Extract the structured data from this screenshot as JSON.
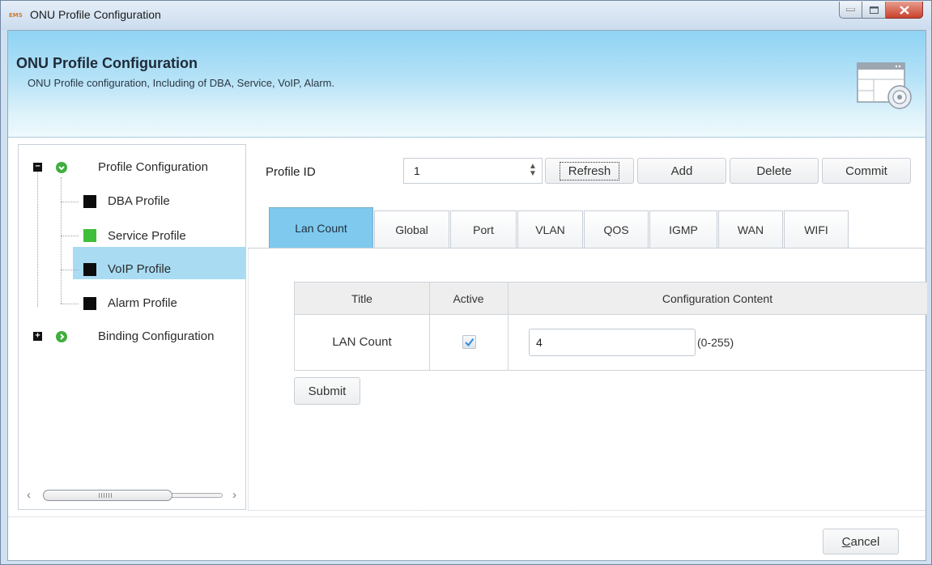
{
  "window": {
    "app_icon_text": "EMS",
    "title": "ONU Profile Configuration",
    "controls": [
      "minimize",
      "maximize",
      "close"
    ]
  },
  "header": {
    "title": "ONU Profile Configuration",
    "description": "ONU Profile configuration, Including of DBA, Service, VoIP, Alarm.",
    "icon": "window-gear-icon"
  },
  "tree": {
    "root": {
      "label": "Profile Configuration",
      "expanded": true,
      "children": [
        {
          "label": "DBA Profile",
          "selected": false
        },
        {
          "label": "Service Profile",
          "selected": true
        },
        {
          "label": "VoIP Profile",
          "selected": false
        },
        {
          "label": "Alarm Profile",
          "selected": false
        }
      ]
    },
    "root2": {
      "label": "Binding Configuration",
      "expanded": false
    },
    "colors": {
      "selected_bg": "#a9dcf3",
      "selected_icon": "#3fbe3a",
      "node_icon": "#3fae3f"
    }
  },
  "toolbar": {
    "profile_label": "Profile ID",
    "profile_value": "1",
    "refresh": "Refresh",
    "add": "Add",
    "delete": "Delete",
    "commit": "Commit"
  },
  "tabs": {
    "items": [
      "Lan Count",
      "Global",
      "Port",
      "VLAN",
      "QOS",
      "IGMP",
      "WAN",
      "WIFI"
    ],
    "active": "Lan Count",
    "active_color": "#7fc9ee"
  },
  "table": {
    "headers": [
      "Title",
      "Active",
      "Configuration Content"
    ],
    "rows": [
      {
        "title": "LAN Count",
        "active": true,
        "value": "4",
        "range": "(0-255)"
      }
    ]
  },
  "submit": "Submit",
  "cancel": "Cancel",
  "cancel_mnemonic": "C",
  "cancel_rest": "ancel"
}
